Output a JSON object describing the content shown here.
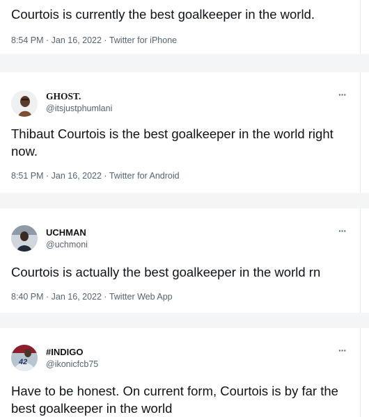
{
  "tweets": [
    {
      "text": "Courtois is currently the best goalkeeper in the world.",
      "meta": "8:54 PM · Jan 16, 2022 · Twitter for iPhone"
    },
    {
      "name": "GHOST.",
      "handle": "@itsjustphumlani",
      "text": "Thibaut Courtois is the best goalkeeper in the world right now.",
      "meta": "8:51 PM · Jan 16, 2022 · Twitter for Android",
      "avatar_icon": "user-avatar-icon"
    },
    {
      "name": "UCHMAN",
      "handle": "@uchmoni",
      "text": "Courtois is actually the best goalkeeper in the world rn",
      "meta": "8:40 PM · Jan 16, 2022 · Twitter Web App",
      "avatar_icon": "user-avatar-icon"
    },
    {
      "name": "#INDIGO",
      "handle": "@ikonicfcb75",
      "text": "Have to be honest. On current form, Courtois is by far the best goalkeeper in the world",
      "avatar_icon": "user-avatar-icon",
      "avatar_text": "42"
    }
  ],
  "more_icon": "more-options-icon",
  "more_glyph": "···"
}
